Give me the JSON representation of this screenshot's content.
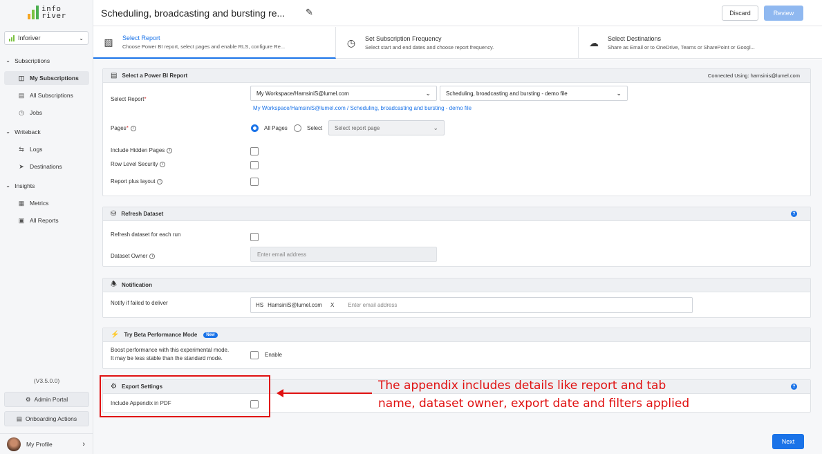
{
  "app": {
    "logo_line1": "info",
    "logo_line2": "river"
  },
  "sidebar": {
    "workspace": "Inforiver",
    "groups": {
      "subscriptions": "Subscriptions",
      "writeback": "Writeback",
      "insights": "Insights"
    },
    "items": {
      "my_subscriptions": "My Subscriptions",
      "all_subscriptions": "All Subscriptions",
      "jobs": "Jobs",
      "logs": "Logs",
      "destinations": "Destinations",
      "metrics": "Metrics",
      "all_reports": "All Reports"
    },
    "version": "(V3.5.0.0)",
    "admin_portal": "Admin Portal",
    "onboarding_actions": "Onboarding Actions",
    "profile": "My Profile"
  },
  "header": {
    "title": "Scheduling, broadcasting and bursting re...",
    "discard": "Discard",
    "review": "Review"
  },
  "steps": [
    {
      "title": "Select Report",
      "desc": "Choose Power BI report, select pages and enable RLS, configure Re..."
    },
    {
      "title": "Set Subscription Frequency",
      "desc": "Select start and end dates and choose report frequency."
    },
    {
      "title": "Select Destinations",
      "desc": "Share as Email or to OneDrive, Teams or SharePoint or Googl..."
    }
  ],
  "report_card": {
    "heading": "Select a Power BI Report",
    "connected": "Connected Using: hamsinis@lumel.com",
    "select_report_label": "Select Report",
    "req": "*",
    "workspace_value": "My Workspace/HamsiniS@lumel.com",
    "report_value": "Scheduling, broadcasting and bursting - demo file",
    "path": "My Workspace/HamsiniS@lumel.com / Scheduling, broadcasting and bursting - demo file",
    "pages_label": "Pages",
    "all_pages": "All Pages",
    "select": "Select",
    "page_placeholder": "Select report page",
    "include_hidden": "Include Hidden Pages",
    "rls": "Row Level Security",
    "layout": "Report plus layout"
  },
  "refresh_card": {
    "heading": "Refresh Dataset",
    "refresh_each": "Refresh dataset for each run",
    "owner_label": "Dataset Owner",
    "owner_placeholder": "Enter email address"
  },
  "notification_card": {
    "heading": "Notification",
    "label": "Notify if failed to deliver",
    "chip_initials": "HS",
    "chip_email": "HamsiniS@lumel.com",
    "chip_remove": "X",
    "placeholder": "Enter email address"
  },
  "beta_card": {
    "heading": "Try Beta Performance Mode",
    "badge": "New",
    "desc_line1": "Boost performance with this experimental mode.",
    "desc_line2": "It may be less stable than the standard mode.",
    "enable": "Enable"
  },
  "export_card": {
    "heading": "Export Settings",
    "appendix": "Include Appendix in PDF"
  },
  "annotation": {
    "line1": "The appendix includes details like report and tab",
    "line2": "name, dataset owner, export date and filters applied"
  },
  "footer": {
    "next": "Next"
  },
  "colors": {
    "accent": "#1a73e8",
    "annotation": "#e01010"
  }
}
